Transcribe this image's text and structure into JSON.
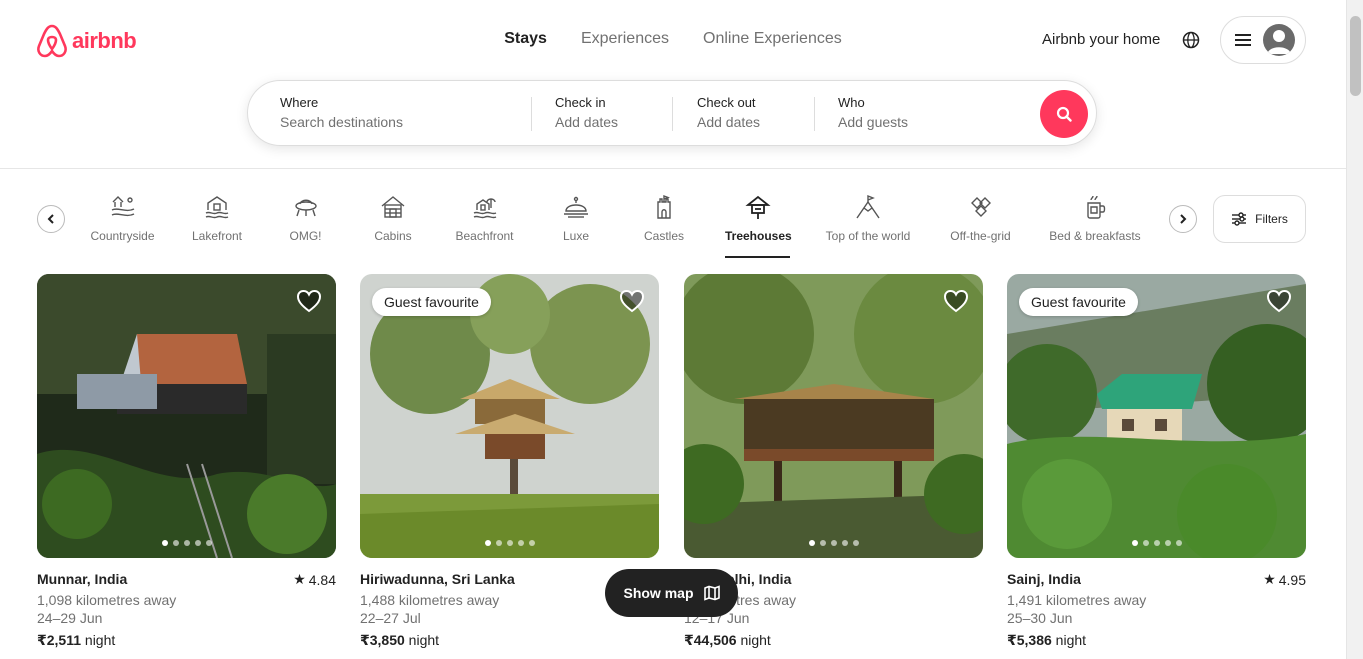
{
  "brand": {
    "name": "airbnb",
    "color": "#ff385c"
  },
  "nav": {
    "tabs": [
      "Stays",
      "Experiences",
      "Online Experiences"
    ],
    "active": "Stays"
  },
  "header": {
    "host_link": "Airbnb your home"
  },
  "search": {
    "where_label": "Where",
    "where_placeholder": "Search destinations",
    "checkin_label": "Check in",
    "checkin_placeholder": "Add dates",
    "checkout_label": "Check out",
    "checkout_placeholder": "Add dates",
    "who_label": "Who",
    "who_placeholder": "Add guests"
  },
  "categories": [
    {
      "label": "Countryside",
      "icon": "countryside-icon"
    },
    {
      "label": "Lakefront",
      "icon": "lakefront-icon"
    },
    {
      "label": "OMG!",
      "icon": "omg-icon"
    },
    {
      "label": "Cabins",
      "icon": "cabins-icon"
    },
    {
      "label": "Beachfront",
      "icon": "beachfront-icon"
    },
    {
      "label": "Luxe",
      "icon": "luxe-icon"
    },
    {
      "label": "Castles",
      "icon": "castles-icon"
    },
    {
      "label": "Treehouses",
      "icon": "treehouses-icon",
      "active": true
    },
    {
      "label": "Top of the world",
      "icon": "mountain-icon"
    },
    {
      "label": "Off-the-grid",
      "icon": "off-grid-icon"
    },
    {
      "label": "Bed & breakfasts",
      "icon": "breakfast-icon"
    }
  ],
  "filters_label": "Filters",
  "listings": [
    {
      "location": "Munnar, India",
      "rating": "4.84",
      "distance": "1,098 kilometres away",
      "dates": "24–29 Jun",
      "price": "₹2,511",
      "price_unit": "night",
      "badge": ""
    },
    {
      "location": "Hiriwadunna, Sri Lanka",
      "rating": "",
      "distance": "1,488 kilometres away",
      "dates": "22–27 Jul",
      "price": "₹3,850",
      "price_unit": "night",
      "badge": "Guest favourite"
    },
    {
      "location": "New Delhi, India",
      "rating": "",
      "distance": "1 kilometres away",
      "dates": "12–17 Jun",
      "price": "₹44,506",
      "price_unit": "night",
      "badge": ""
    },
    {
      "location": "Sainj, India",
      "rating": "4.95",
      "distance": "1,491 kilometres away",
      "dates": "25–30 Jun",
      "price": "₹5,386",
      "price_unit": "night",
      "badge": "Guest favourite"
    }
  ],
  "show_map_label": "Show map"
}
